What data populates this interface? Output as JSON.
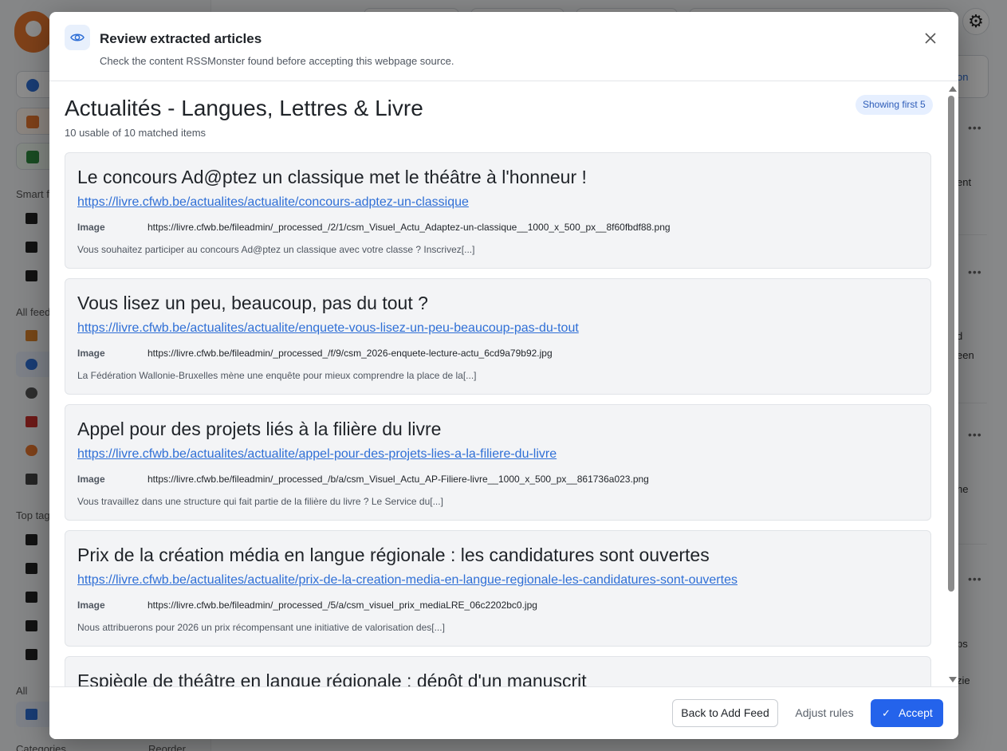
{
  "dialog": {
    "title": "Review extracted articles",
    "subtitle": "Check the content RSSMonster found before accepting this webpage source.",
    "close_icon": "close-icon",
    "header_icon": "eye-icon"
  },
  "source": {
    "title": "Actualités - Langues, Lettres & Livre",
    "count_text": "10 usable of 10 matched items",
    "showing_badge": "Showing first 5"
  },
  "image_label": "Image",
  "articles": [
    {
      "title": "Le concours Ad@ptez un classique met le théâtre à l'honneur !",
      "url": "https://livre.cfwb.be/actualites/actualite/concours-adptez-un-classique",
      "image": "https://livre.cfwb.be/fileadmin/_processed_/2/1/csm_Visuel_Actu_Adaptez-un-classique__1000_x_500_px__8f60fbdf88.png",
      "description": "Vous souhaitez participer au concours Ad@ptez un classique avec votre classe ? Inscrivez[...]"
    },
    {
      "title": "Vous lisez un peu, beaucoup, pas du tout ?",
      "url": "https://livre.cfwb.be/actualites/actualite/enquete-vous-lisez-un-peu-beaucoup-pas-du-tout",
      "image": "https://livre.cfwb.be/fileadmin/_processed_/f/9/csm_2026-enquete-lecture-actu_6cd9a79b92.jpg",
      "description": "La Fédération Wallonie-Bruxelles mène une enquête pour mieux comprendre la place de la[...]"
    },
    {
      "title": "Appel pour des projets liés à la filière du livre",
      "url": "https://livre.cfwb.be/actualites/actualite/appel-pour-des-projets-lies-a-la-filiere-du-livre",
      "image": "https://livre.cfwb.be/fileadmin/_processed_/b/a/csm_Visuel_Actu_AP-Filiere-livre__1000_x_500_px__861736a023.png",
      "description": "Vous travaillez dans une structure qui fait partie de la filière du livre ? Le Service du[...]"
    },
    {
      "title": "Prix de la création média en langue régionale : les candidatures sont ouvertes",
      "url": "https://livre.cfwb.be/actualites/actualite/prix-de-la-creation-media-en-langue-regionale-les-candidatures-sont-ouvertes",
      "image": "https://livre.cfwb.be/fileadmin/_processed_/5/a/csm_visuel_prix_mediaLRE_06c2202bc0.jpg",
      "description": "Nous attribuerons pour 2026 un prix récompensant une initiative de valorisation des[...]"
    },
    {
      "title": "Espiègle de théâtre en langue régionale : dépôt d'un manuscrit"
    }
  ],
  "footer": {
    "back_label": "Back to Add Feed",
    "adjust_label": "Adjust rules",
    "accept_label": "Accept",
    "accept_icon": "check-icon"
  },
  "background": {
    "section_smart": "Smart f",
    "section_all_feeds": "All feed",
    "section_top_tags": "Top tag",
    "section_all": "All",
    "section_categories": "Categories",
    "reorder": "Reorder",
    "card_snippets": [
      "ent",
      "d",
      "een",
      "he",
      "ps",
      "zie",
      "on"
    ]
  }
}
